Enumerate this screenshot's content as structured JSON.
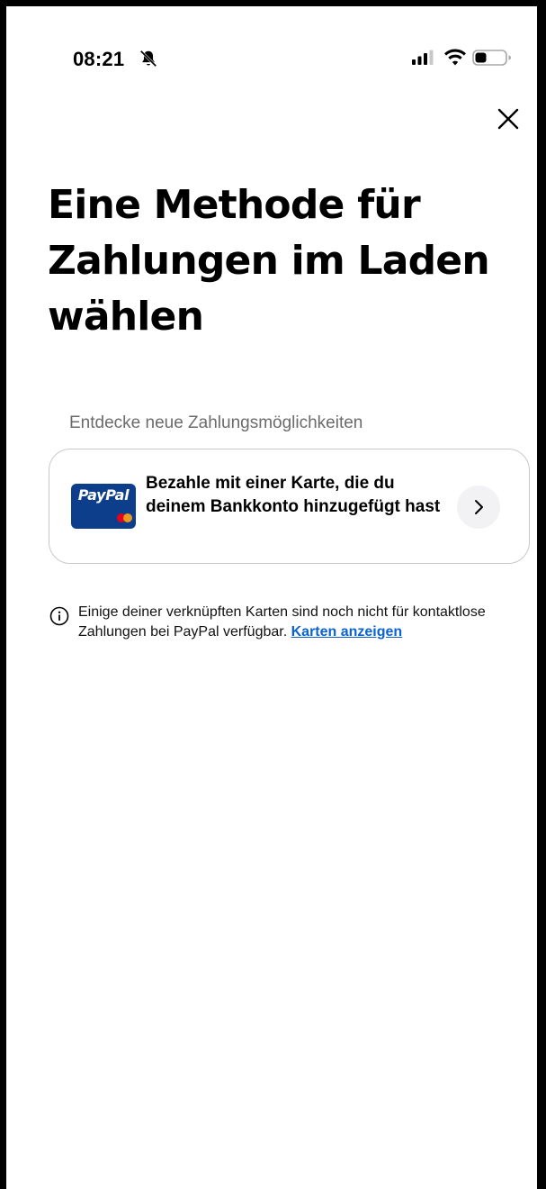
{
  "status_bar": {
    "time": "08:21",
    "icons": [
      "bell-muted-icon",
      "signal-icon",
      "wifi-icon",
      "battery-icon"
    ]
  },
  "header": {
    "close_icon": "close-icon"
  },
  "page": {
    "title": "Eine Methode für Zahlungen im Laden wählen",
    "section_label": "Entdecke neue Zahlungsmöglichkeiten"
  },
  "option": {
    "brand_logo": "PayPal",
    "text": "Bezahle mit einer Karte, die du deinem Bankkonto hinzugefügt hast",
    "chevron_icon": "chevron-right-icon"
  },
  "info": {
    "text": "Einige deiner verknüpften Karten sind noch nicht für kontaktlose Zahlungen bei PayPal verfügbar.",
    "link_label": "Karten anzeigen",
    "icon": "info-icon"
  },
  "colors": {
    "background": "#ffffff",
    "paypal_blue": "#0d3e8c",
    "link_blue": "#0b63d1",
    "muted_text": "#6b6b6b",
    "card_border": "#c9c9c9"
  }
}
